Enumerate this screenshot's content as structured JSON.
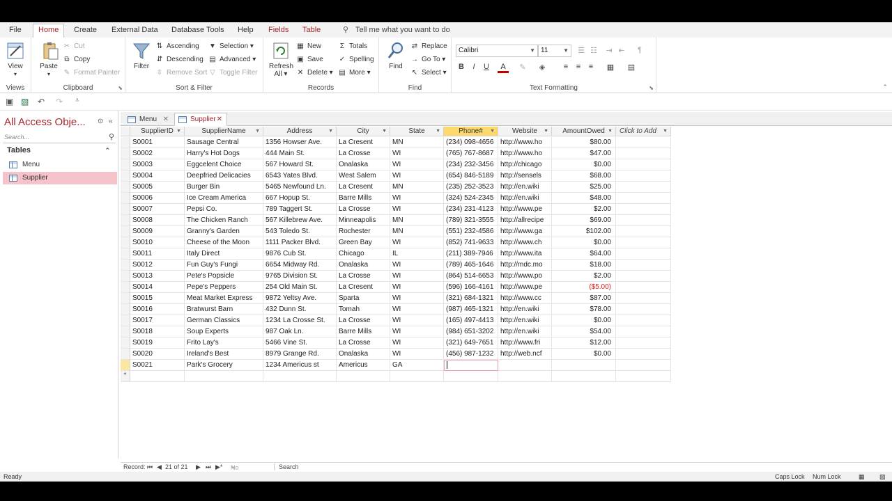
{
  "ribbon_tabs": [
    "File",
    "Home",
    "Create",
    "External Data",
    "Database Tools",
    "Help",
    "Fields",
    "Table"
  ],
  "tell_me": "Tell me what you want to do",
  "views": {
    "view": "View",
    "label": "Views"
  },
  "clipboard": {
    "paste": "Paste",
    "cut": "Cut",
    "copy": "Copy",
    "format_painter": "Format Painter",
    "label": "Clipboard"
  },
  "sort_filter": {
    "filter": "Filter",
    "ascending": "Ascending",
    "descending": "Descending",
    "remove_sort": "Remove Sort",
    "selection": "Selection",
    "advanced": "Advanced",
    "toggle_filter": "Toggle Filter",
    "label": "Sort & Filter"
  },
  "records": {
    "refresh": "Refresh",
    "refresh_all": "All",
    "new": "New",
    "save": "Save",
    "delete": "Delete",
    "totals": "Totals",
    "spelling": "Spelling",
    "more": "More",
    "label": "Records"
  },
  "find": {
    "find": "Find",
    "replace": "Replace",
    "goto": "Go To",
    "select": "Select",
    "label": "Find"
  },
  "text_formatting": {
    "font": "Calibri",
    "size": "11",
    "label": "Text Formatting",
    "bold": "B",
    "italic": "I",
    "underline": "U"
  },
  "nav": {
    "title": "All Access Obje...",
    "search_placeholder": "Search...",
    "section": "Tables",
    "items": [
      "Menu",
      "Supplier"
    ]
  },
  "doc_tabs": [
    "Menu",
    "Supplier"
  ],
  "columns": [
    "SupplierID",
    "SupplierName",
    "Address",
    "City",
    "State",
    "Phone#",
    "Website",
    "AmountOwed",
    "Click to Add"
  ],
  "rows": [
    [
      "S0001",
      "Sausage Central",
      "1356 Howser Ave.",
      "La Cresent",
      "MN",
      "(234) 098-4656",
      "http://www.ho",
      "$80.00"
    ],
    [
      "S0002",
      "Harry's Hot Dogs",
      "444 Main St.",
      "La Crosse",
      "WI",
      "(765) 767-8687",
      "http://www.ho",
      "$47.00"
    ],
    [
      "S0003",
      "Eggcelent Choice",
      "567 Howard St.",
      "Onalaska",
      "WI",
      "(234) 232-3456",
      "http://chicago",
      "$0.00"
    ],
    [
      "S0004",
      "Deepfried Delicacies",
      "6543 Yates Blvd.",
      "West Salem",
      "WI",
      "(654) 846-5189",
      "http://sensels",
      "$68.00"
    ],
    [
      "S0005",
      "Burger Bin",
      "5465 Newfound Ln.",
      "La Cresent",
      "MN",
      "(235) 252-3523",
      "http://en.wiki",
      "$25.00"
    ],
    [
      "S0006",
      "Ice Cream America",
      "667 Hopup St.",
      "Barre Mills",
      "WI",
      "(324) 524-2345",
      "http://en.wiki",
      "$48.00"
    ],
    [
      "S0007",
      "Pepsi Co.",
      "789 Taggert St.",
      "La Crosse",
      "WI",
      "(234) 231-4123",
      "http://www.pe",
      "$2.00"
    ],
    [
      "S0008",
      "The Chicken Ranch",
      "567 Killebrew Ave.",
      "Minneapolis",
      "MN",
      "(789) 321-3555",
      "http://allrecipe",
      "$69.00"
    ],
    [
      "S0009",
      "Granny's Garden",
      "543 Toledo St.",
      "Rochester",
      "MN",
      "(551) 232-4586",
      "http://www.ga",
      "$102.00"
    ],
    [
      "S0010",
      "Cheese of the Moon",
      "1111 Packer Blvd.",
      "Green Bay",
      "WI",
      "(852) 741-9633",
      "http://www.ch",
      "$0.00"
    ],
    [
      "S0011",
      "Italy Direct",
      "9876 Cub St.",
      "Chicago",
      "IL",
      "(211) 389-7946",
      "http://www.ita",
      "$64.00"
    ],
    [
      "S0012",
      "Fun Guy's Fungi",
      "6654 Midway Rd.",
      "Onalaska",
      "WI",
      "(789) 465-1646",
      "http://mdc.mo",
      "$18.00"
    ],
    [
      "S0013",
      "Pete's Popsicle",
      "9765 Division St.",
      "La Crosse",
      "WI",
      "(864) 514-6653",
      "http://www.po",
      "$2.00"
    ],
    [
      "S0014",
      "Pepe's Peppers",
      "254 Old Main St.",
      "La Cresent",
      "WI",
      "(596) 166-4161",
      "http://www.pe",
      "($5.00)"
    ],
    [
      "S0015",
      "Meat Market Express",
      "9872 Yeltsy Ave.",
      "Sparta",
      "WI",
      "(321) 684-1321",
      "http://www.cc",
      "$87.00"
    ],
    [
      "S0016",
      "Bratwurst Barn",
      "432 Dunn St.",
      "Tomah",
      "WI",
      "(987) 465-1321",
      "http://en.wiki",
      "$78.00"
    ],
    [
      "S0017",
      "German Classics",
      "1234 La Crosse St.",
      "La Crosse",
      "WI",
      "(165) 497-4413",
      "http://en.wiki",
      "$0.00"
    ],
    [
      "S0018",
      "Soup Experts",
      "987 Oak Ln.",
      "Barre Mills",
      "WI",
      "(984) 651-3202",
      "http://en.wiki",
      "$54.00"
    ],
    [
      "S0019",
      "Frito Lay's",
      "5466 Vine St.",
      "La Crosse",
      "WI",
      "(321) 649-7651",
      "http://www.fri",
      "$12.00"
    ],
    [
      "S0020",
      "Ireland's Best",
      "8979 Grange Rd.",
      "Onalaska",
      "WI",
      "(456) 987-1232",
      "http://web.ncf",
      "$0.00"
    ],
    [
      "S0021",
      "Park's Grocery",
      "1234 Americus st",
      "Americus",
      "GA",
      "",
      "",
      ""
    ]
  ],
  "record_nav": {
    "label": "Record:",
    "position": "21 of 21",
    "filter": "No Filter",
    "search": "Search"
  },
  "status": {
    "left": "Ready",
    "caps": "Caps Lock",
    "num": "Num Lock"
  },
  "colors": {
    "accent": "#a4262c",
    "selected_header": "#fdd86b",
    "nav_selected": "#f5c3c9",
    "negative": "#e31b1b"
  }
}
